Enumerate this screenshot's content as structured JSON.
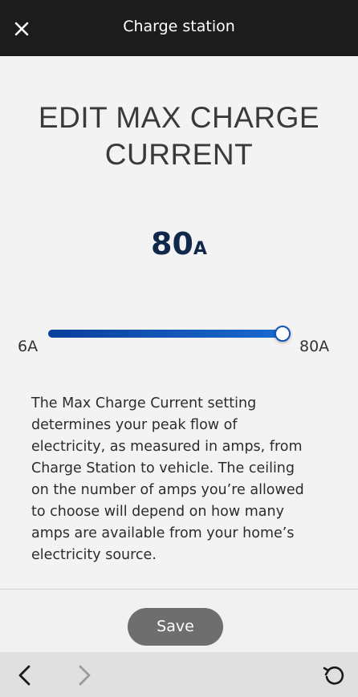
{
  "header": {
    "title": "Charge station",
    "close_icon": "close-icon"
  },
  "page_title": "EDIT MAX CHARGE CURRENT",
  "current": {
    "value": "80",
    "unit": "A",
    "fraction": 1.0
  },
  "slider": {
    "min_label": "6A",
    "max_label": "80A",
    "min": 6,
    "max": 80,
    "value": 80
  },
  "description": "The Max Charge Current setting determines your peak flow of electricity, as measured in amps, from Charge Station to vehicle. The ceiling on the number of amps you’re allowed to choose will depend on how many amps are available from your home’s electricity source.",
  "footer": {
    "save_label": "Save"
  },
  "bottom_nav": {
    "back_icon": "chevron-left-icon",
    "forward_icon": "chevron-right-icon",
    "refresh_icon": "refresh-icon"
  },
  "colors": {
    "header_bg": "#1c1c1c",
    "accent": "#1653b8",
    "value_text": "#10284a",
    "save_button_bg": "#6e6e6e"
  }
}
